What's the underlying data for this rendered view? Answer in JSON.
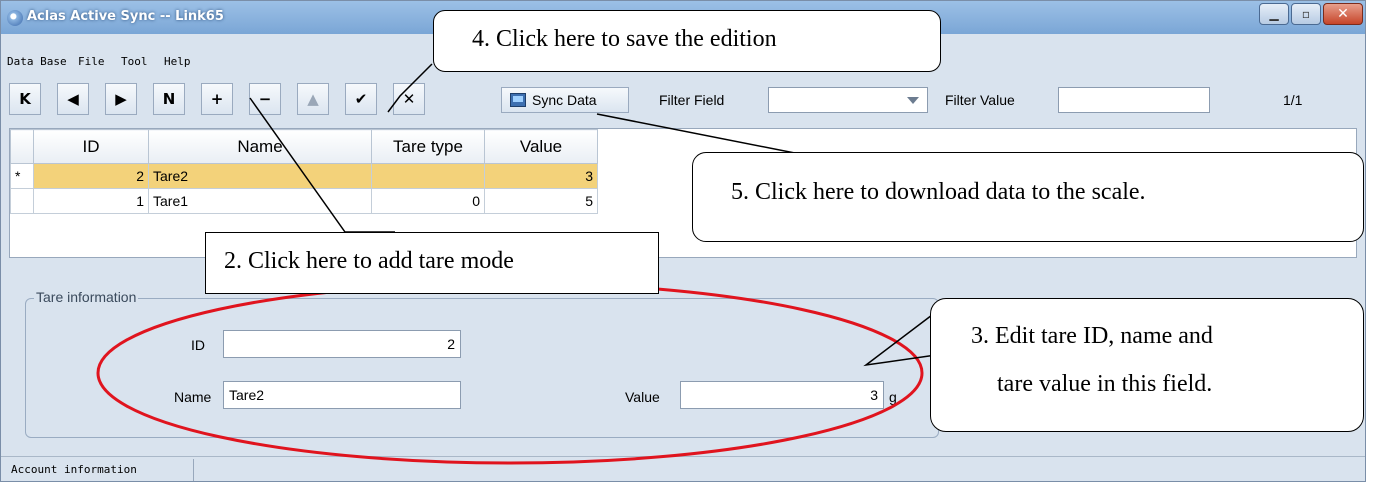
{
  "window": {
    "title": "Aclas Active Sync -- Link65"
  },
  "menu": {
    "items": [
      "Data Base",
      "File",
      "Tool",
      "Help"
    ]
  },
  "toolbar": {
    "nav": [
      "K",
      "◀",
      "▶",
      "N",
      "+",
      "−",
      "▲",
      "✔",
      "✕"
    ],
    "sync_label": "Sync Data",
    "filter_field_label": "Filter Field",
    "filter_field_value": "",
    "filter_value_label": "Filter Value",
    "filter_value": "",
    "page_info": "1/1"
  },
  "grid": {
    "columns": [
      "ID",
      "Name",
      "Tare type",
      "Value"
    ],
    "rows": [
      {
        "indicator": "*",
        "id": "2",
        "name": "Tare2",
        "tare_type": "",
        "value": "3",
        "selected": true
      },
      {
        "indicator": "",
        "id": "1",
        "name": "Tare1",
        "tare_type": "0",
        "value": "5",
        "selected": false
      }
    ]
  },
  "tare_info": {
    "group_title": "Tare information",
    "id_label": "ID",
    "id_value": "2",
    "name_label": "Name",
    "name_value": "Tare2",
    "value_label": "Value",
    "value_value": "3",
    "unit": "g"
  },
  "status": {
    "text": "Account information"
  },
  "callouts": {
    "c4": "4.   Click here to save the edition",
    "c5": "5.   Click here to download data to the scale.",
    "c2": "2.   Click here to add tare mode",
    "c3_line1": "3.  Edit  tare  ID,  name  and",
    "c3_line2": "tare value in this field."
  },
  "colors": {
    "selected_row": "#f3d27a",
    "highlight_ellipse": "#e0141e",
    "titlebar": "#7aa6d6"
  }
}
